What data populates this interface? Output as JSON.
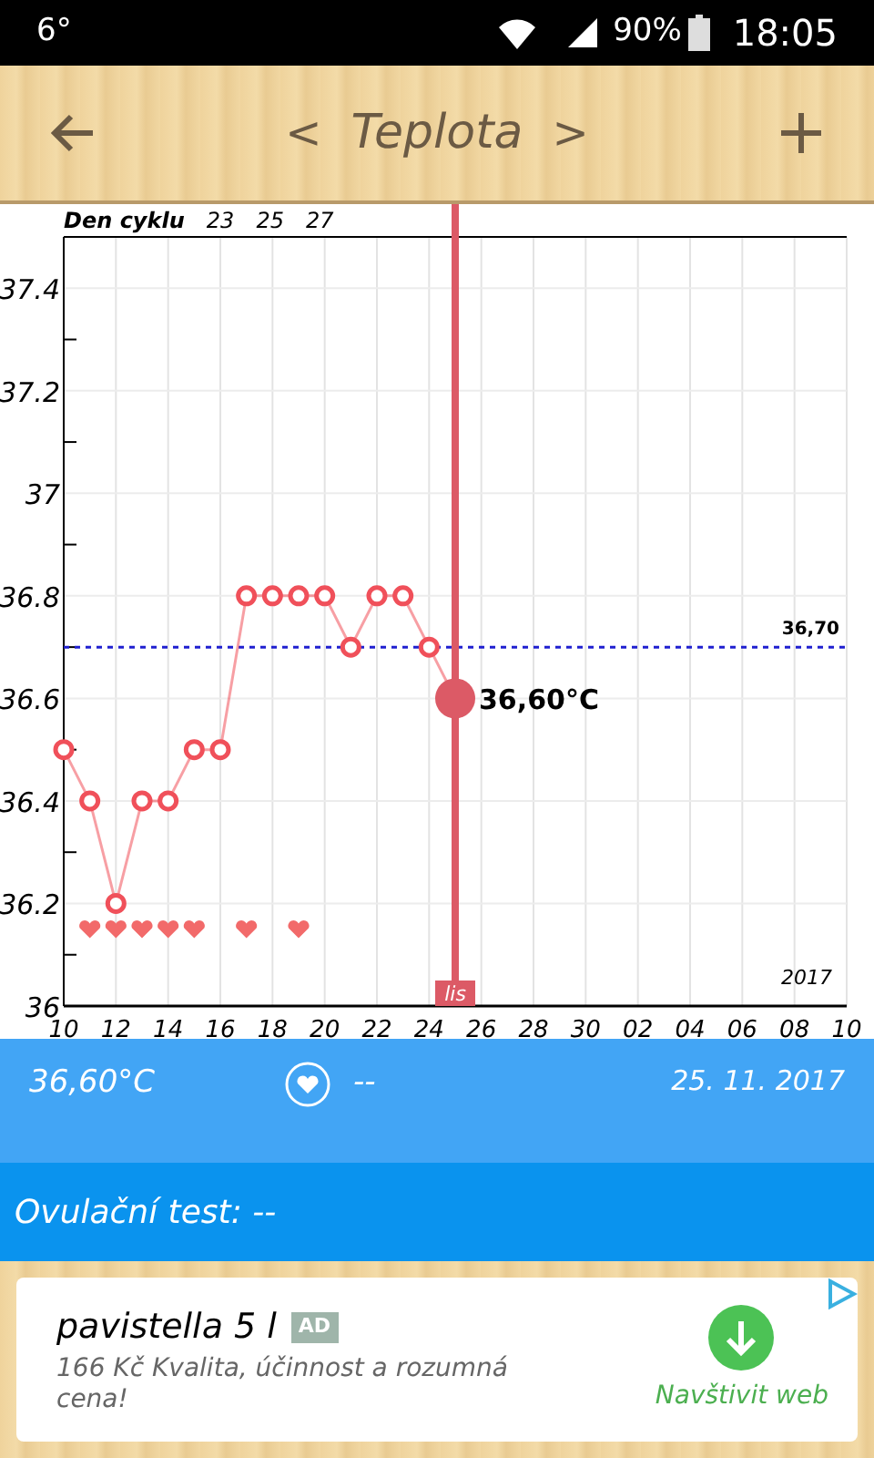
{
  "status_bar": {
    "temperature": "6°",
    "battery": "90%",
    "time": "18:05"
  },
  "header": {
    "prev": "<",
    "title": "Teplota",
    "next": ">"
  },
  "cycle_row": {
    "label": "Den cyklu",
    "days": [
      "23",
      "25",
      "27"
    ]
  },
  "chart_data": {
    "type": "line",
    "grid": true,
    "x": [
      "2017-11-10",
      "2017-11-11",
      "2017-11-12",
      "2017-11-13",
      "2017-11-14",
      "2017-11-15",
      "2017-11-16",
      "2017-11-17",
      "2017-11-18",
      "2017-11-19",
      "2017-11-20",
      "2017-11-21",
      "2017-11-22",
      "2017-11-23",
      "2017-11-24",
      "2017-11-25"
    ],
    "series": [
      {
        "color": "#f0505a",
        "marker": "o",
        "values": [
          36.5,
          36.4,
          36.2,
          36.4,
          36.4,
          36.5,
          36.5,
          36.8,
          36.8,
          36.8,
          36.8,
          36.7,
          36.8,
          36.8,
          36.7,
          36.6
        ]
      },
      {
        "type": "scatter",
        "color": "#f26a6a",
        "values": [
          null,
          36.15,
          36.15,
          36.15,
          36.15,
          36.15,
          null,
          36.15,
          null,
          36.15,
          null,
          null,
          null,
          null,
          null,
          null
        ]
      }
    ],
    "xlim": [
      "2017-11-10",
      "2017-12-10"
    ],
    "ylim": [
      36,
      37.5
    ],
    "xticks": [
      {
        "value": "2017-11-10",
        "label": "10"
      },
      {
        "value": "2017-11-12",
        "label": "12"
      },
      {
        "value": "2017-11-14",
        "label": "14"
      },
      {
        "value": "2017-11-16",
        "label": "16"
      },
      {
        "value": "2017-11-18",
        "label": "18"
      },
      {
        "value": "2017-11-20",
        "label": "20"
      },
      {
        "value": "2017-11-22",
        "label": "22"
      },
      {
        "value": "2017-11-24",
        "label": "24"
      },
      {
        "value": "2017-11-26",
        "label": "26"
      },
      {
        "value": "2017-11-28",
        "label": "28"
      },
      {
        "value": "2017-11-30",
        "label": "30"
      },
      {
        "value": "2017-12-02",
        "label": "02"
      },
      {
        "value": "2017-12-04",
        "label": "04"
      },
      {
        "value": "2017-12-06",
        "label": "06"
      },
      {
        "value": "2017-12-08",
        "label": "08"
      },
      {
        "value": "2017-12-10",
        "label": "10"
      }
    ],
    "yticks": [
      {
        "value": 36,
        "label": "36"
      },
      {
        "value": 36.2,
        "label": "36.2"
      },
      {
        "value": 36.4,
        "label": "36.4"
      },
      {
        "value": 36.6,
        "label": "36.6"
      },
      {
        "value": 36.8,
        "label": "36.8"
      },
      {
        "value": 37,
        "label": "37"
      },
      {
        "value": 37.2,
        "label": "37.2"
      },
      {
        "value": 37.4,
        "label": "37.4"
      }
    ],
    "ref_lines": [
      {
        "axis": "y",
        "value": 36.7,
        "label": "36,70",
        "color": "#2020d0"
      },
      {
        "axis": "x",
        "value": "2017-11-25",
        "label": "lis",
        "color": "#dc5a66"
      }
    ]
  },
  "chart_marks": {
    "selected_label": "36,60°C",
    "year": "2017"
  },
  "info_bar": {
    "temperature": "36,60°C",
    "intercourse": "--",
    "date": "25. 11. 2017"
  },
  "ovulation": {
    "label": "Ovulační test: --"
  },
  "ad": {
    "title": "pavistella 5 l",
    "badge": "AD",
    "text": "166 Kč Kvalita, účinnost a rozumná cena!",
    "action": "Navštivit web"
  }
}
